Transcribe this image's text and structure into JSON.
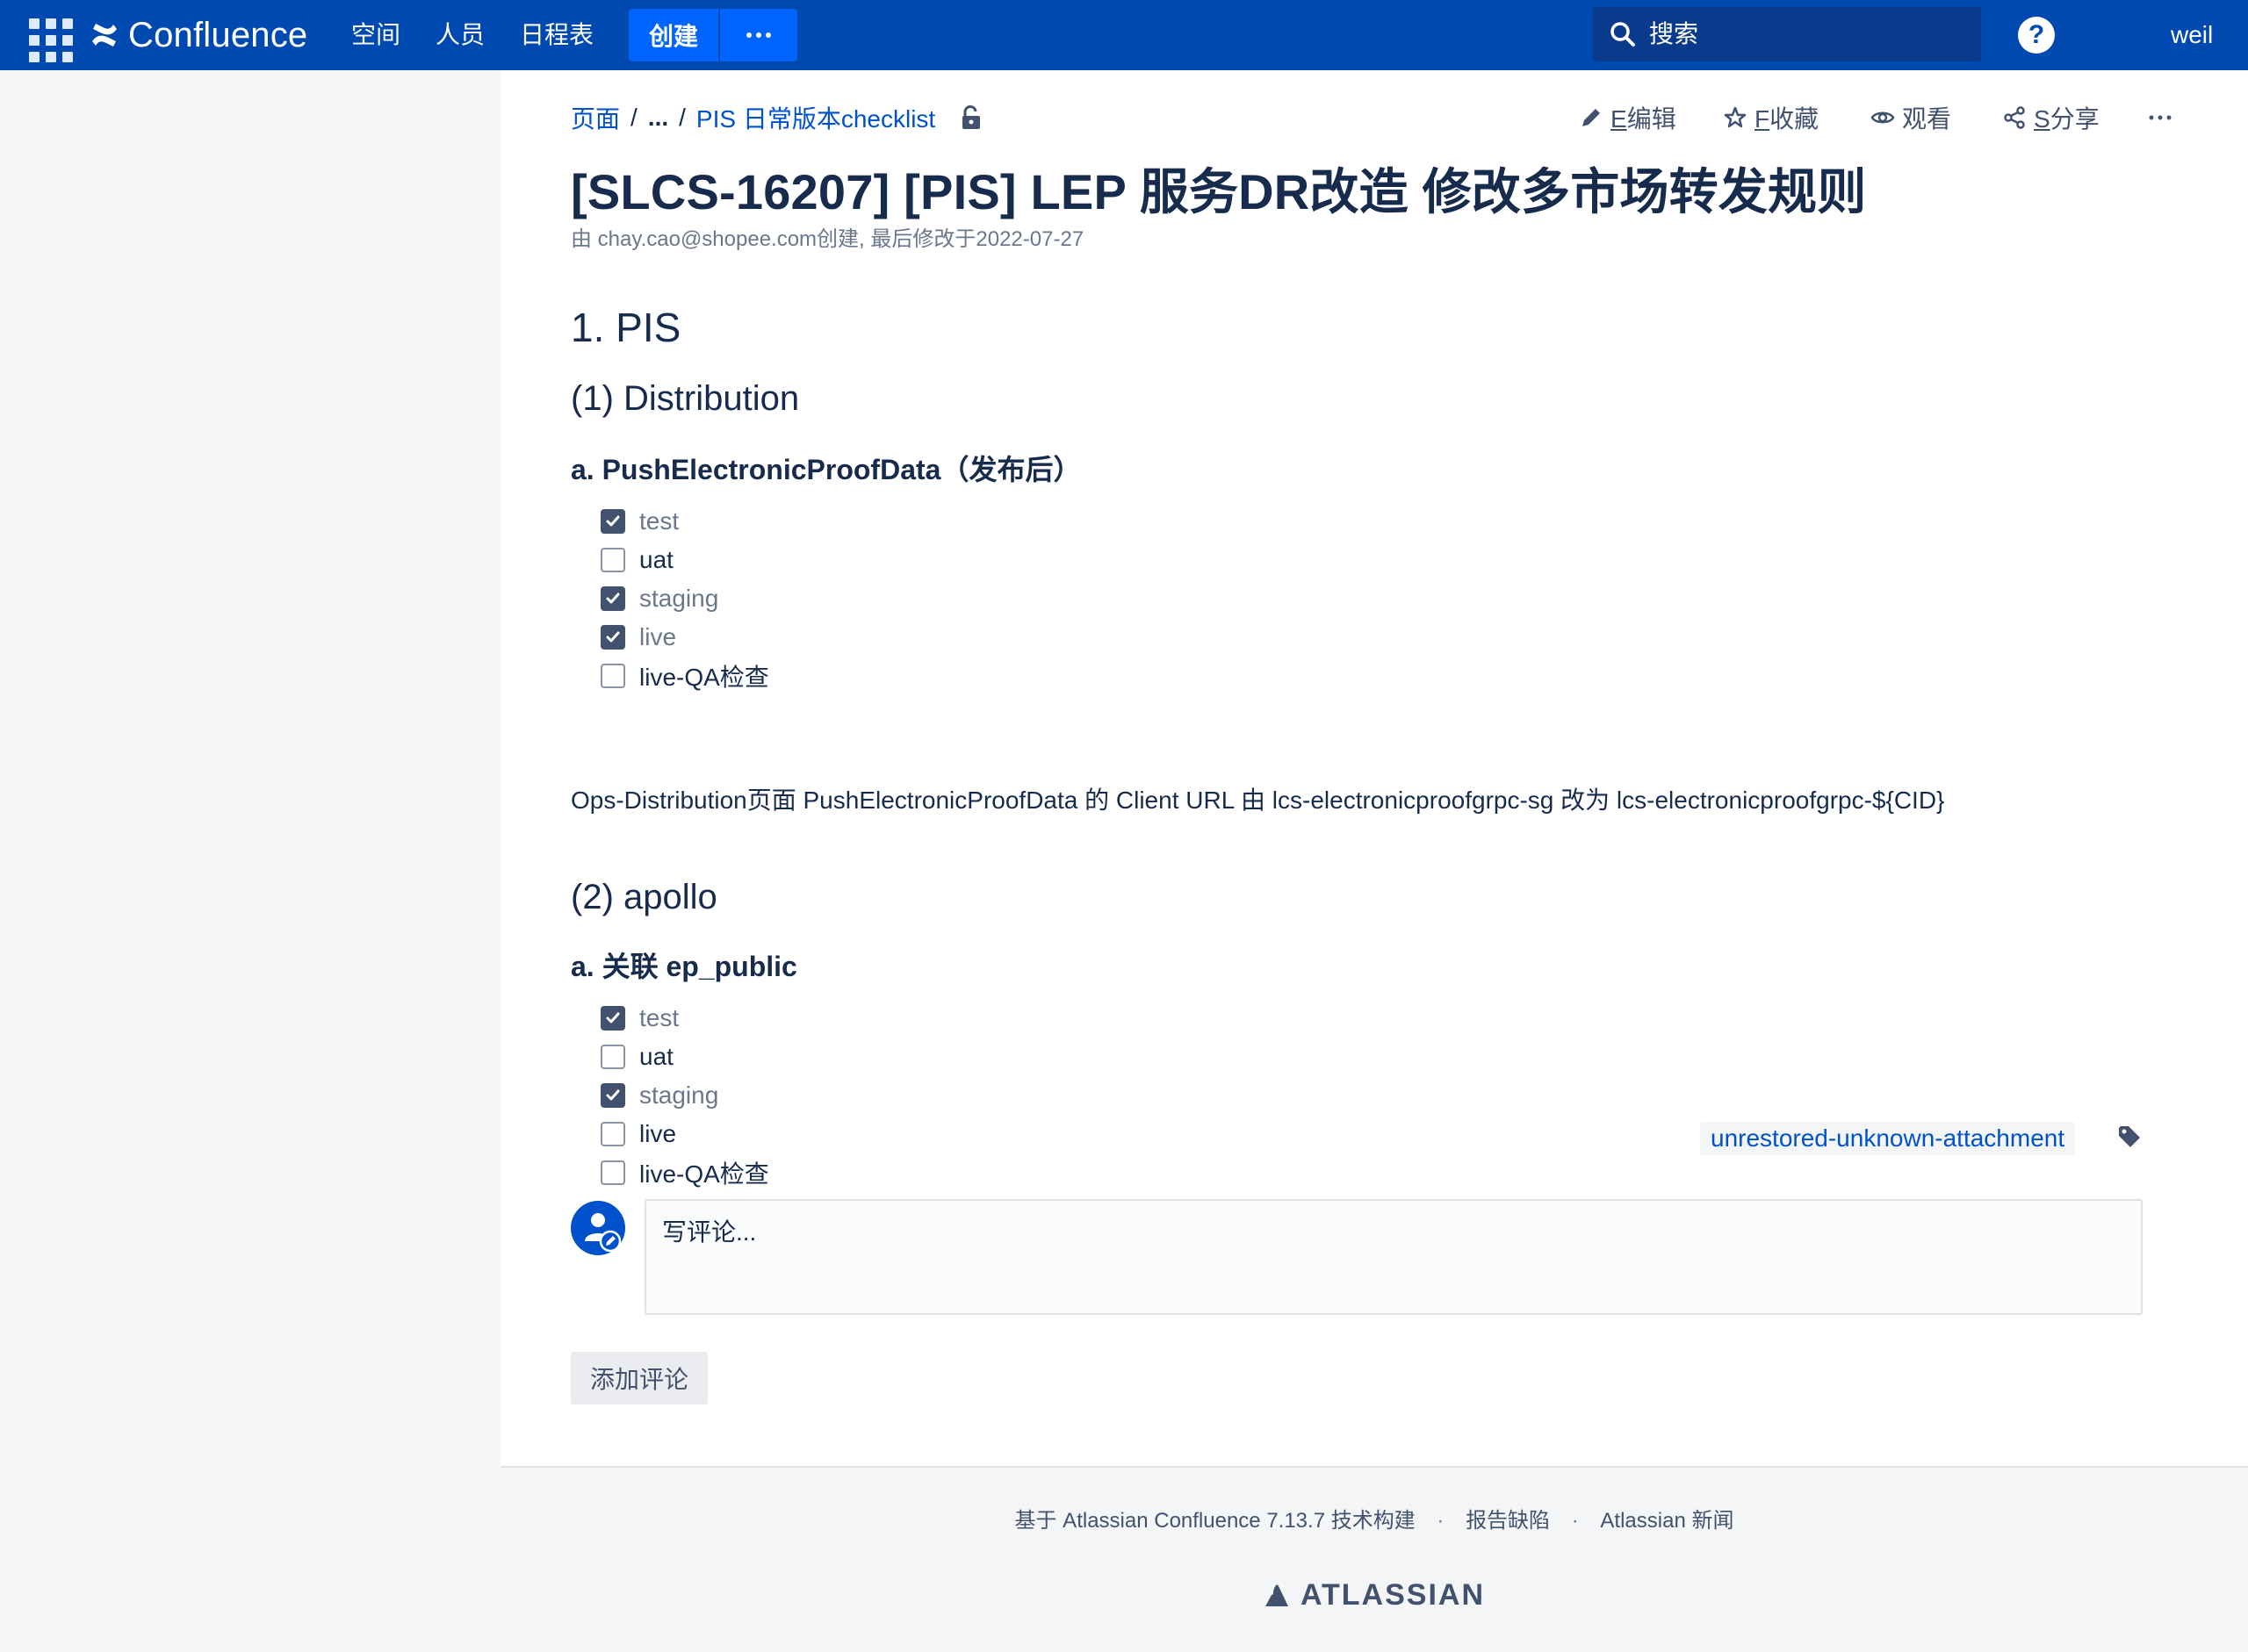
{
  "header": {
    "app_name": "Confluence",
    "nav": [
      "空间",
      "人员",
      "日程表"
    ],
    "create_label": "创建",
    "more_label": "···",
    "search_placeholder": "搜索",
    "help_label": "?",
    "user": "weil"
  },
  "breadcrumb": {
    "root": "页面",
    "sep1": "/",
    "ellipsis": "...",
    "sep2": "/",
    "parent": "PIS 日常版本checklist"
  },
  "actions": {
    "edit": {
      "key": "E",
      "label": "编辑"
    },
    "favorite": {
      "key": "F",
      "label": "收藏"
    },
    "watch": {
      "label": "观看"
    },
    "share": {
      "key": "S",
      "label": "分享"
    },
    "more": "···"
  },
  "page": {
    "title": "[SLCS-16207] [PIS] LEP 服务DR改造 修改多市场转发规则",
    "meta": "由 chay.cao@shopee.com创建, 最后修改于2022-07-27"
  },
  "content": {
    "h1": "1. PIS",
    "section1": {
      "heading": "(1) Distribution",
      "subheading": "a. PushElectronicProofData（发布后）",
      "tasks": [
        {
          "label": "test",
          "done": true
        },
        {
          "label": "uat",
          "done": false
        },
        {
          "label": "staging",
          "done": true
        },
        {
          "label": "live",
          "done": true
        },
        {
          "label": "live-QA检查",
          "done": false
        }
      ],
      "note": "Ops-Distribution页面 PushElectronicProofData 的 Client URL 由 lcs-electronicproofgrpc-sg 改为 lcs-electronicproofgrpc-${CID}"
    },
    "section2": {
      "heading": "(2) apollo",
      "subheading": "a. 关联 ep_public",
      "tasks": [
        {
          "label": "test",
          "done": true
        },
        {
          "label": "uat",
          "done": false
        },
        {
          "label": "staging",
          "done": true
        },
        {
          "label": "live",
          "done": false
        },
        {
          "label": "live-QA检查",
          "done": false
        }
      ]
    }
  },
  "labels": [
    "unrestored-unknown-attachment"
  ],
  "comment": {
    "placeholder": "写评论...",
    "button": "添加评论"
  },
  "footer": {
    "built_with": "基于 Atlassian Confluence 7.13.7 技术构建",
    "report_bug": "报告缺陷",
    "news": "Atlassian 新闻",
    "brand": "ATLASSIAN"
  },
  "colors": {
    "topbar": "#0049b0",
    "accent": "#0065ff",
    "link": "#0052cc",
    "text": "#172b4d"
  }
}
